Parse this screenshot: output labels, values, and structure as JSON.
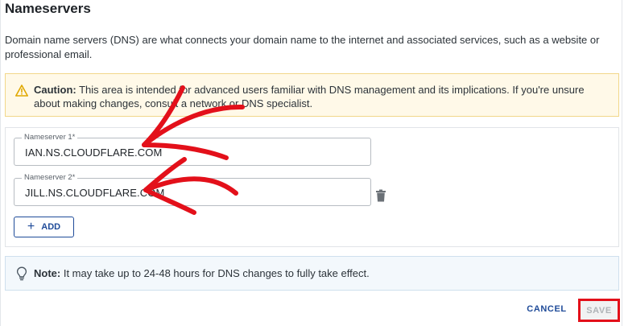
{
  "section": {
    "title": "Nameservers",
    "description": "Domain name servers (DNS) are what connects your domain name to the internet and associated services, such as a website or professional email."
  },
  "caution": {
    "label": "Caution:",
    "text": " This area is intended for advanced users familiar with DNS management and its implications. If you're unsure about making changes, consult a network or DNS specialist.",
    "icon": "warning-triangle-icon",
    "color": "#f2b705"
  },
  "nameservers": [
    {
      "label": "Nameserver 1*",
      "value": "IAN.NS.CLOUDFLARE.COM"
    },
    {
      "label": "Nameserver 2*",
      "value": "JILL.NS.CLOUDFLARE.COM"
    }
  ],
  "add_button": {
    "icon": "+",
    "label": "ADD"
  },
  "note": {
    "label": "Note:",
    "text": " It may take up to 24-48 hours for DNS changes to fully take effect.",
    "icon": "lightbulb-icon"
  },
  "actions": {
    "cancel_label": "CANCEL",
    "save_label": "SAVE"
  },
  "colors": {
    "accent": "#1f4b99",
    "annotation_red": "#e3101a"
  }
}
